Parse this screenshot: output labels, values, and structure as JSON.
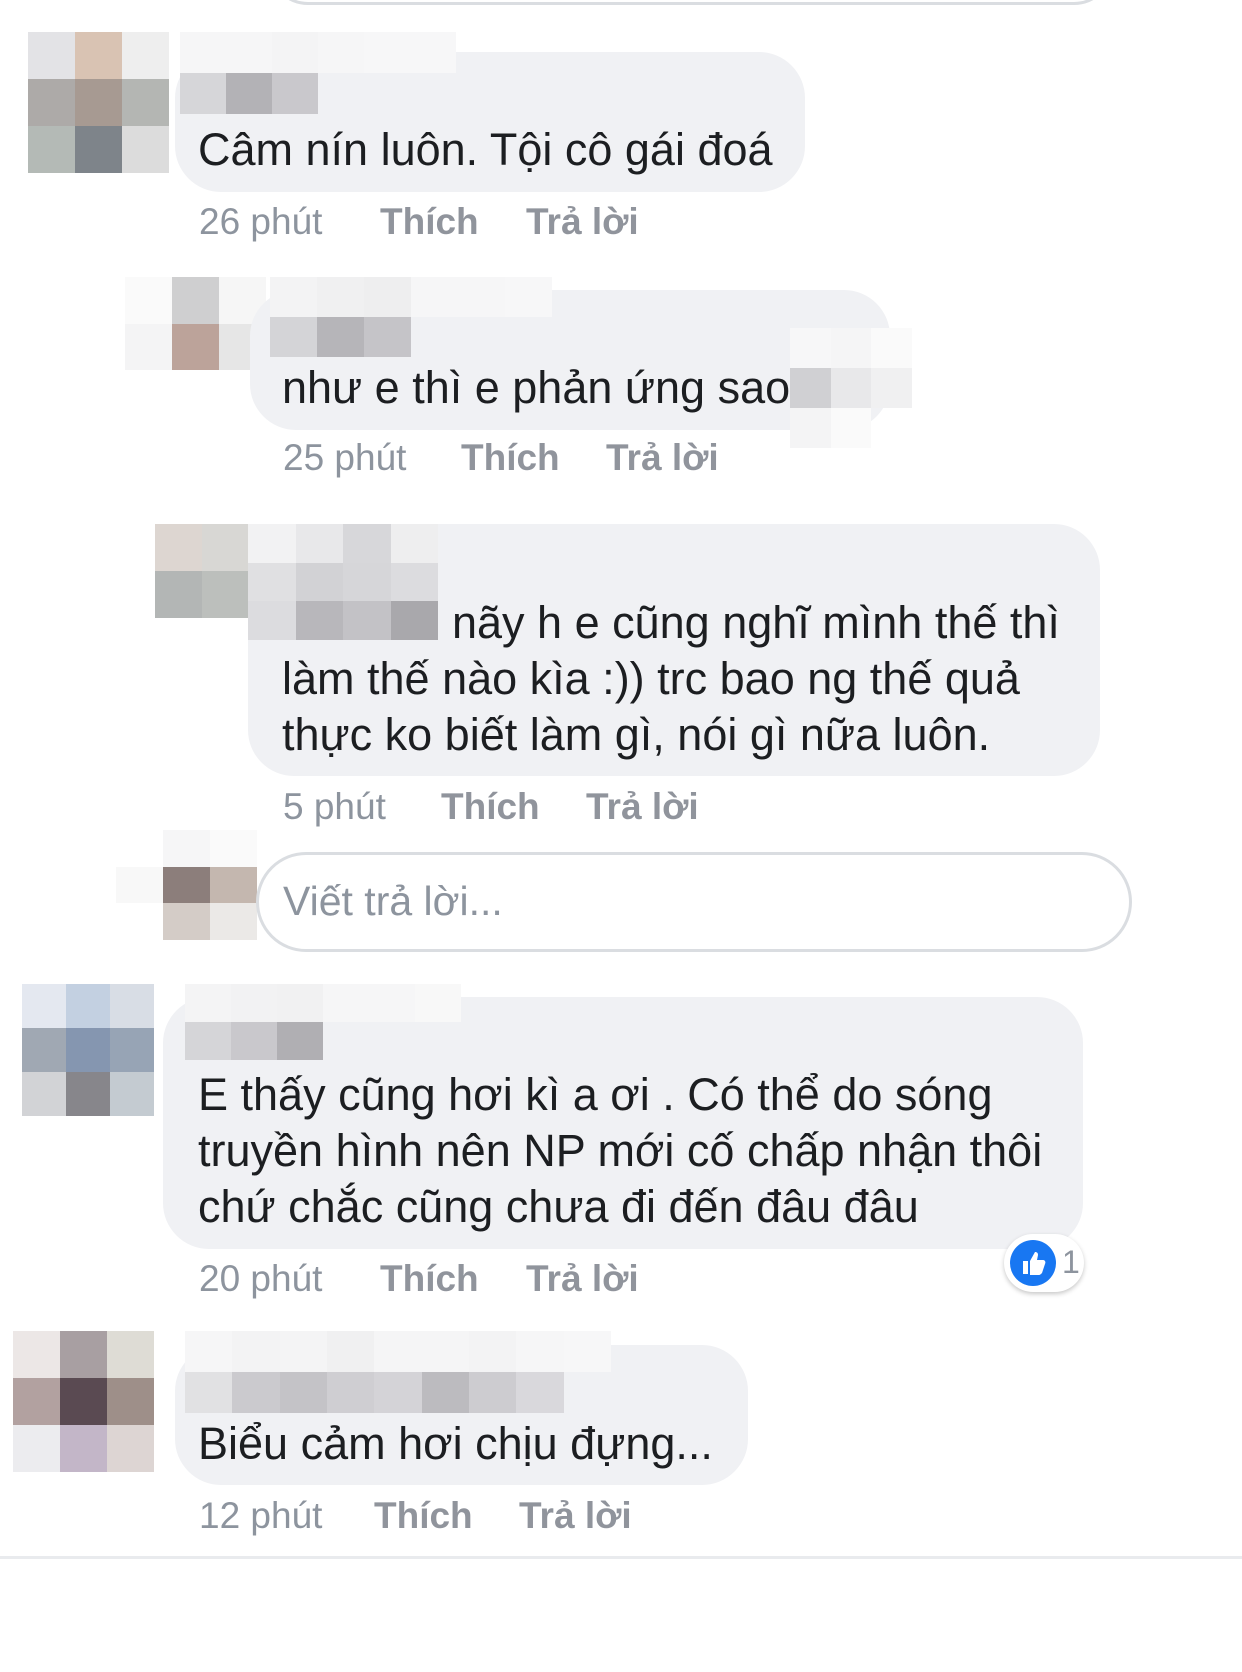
{
  "comments": [
    {
      "text_lines": [
        "Câm nín luôn. Tội cô gái đoá"
      ],
      "time": "26 phút",
      "like_label": "Thích",
      "reply_label": "Trả lời"
    },
    {
      "text_lines": [
        "như e thì e phản ứng sao"
      ],
      "time": "25 phút",
      "like_label": "Thích",
      "reply_label": "Trả lời"
    },
    {
      "text_lines": [
        "nãy h e cũng nghĩ mình thế thì",
        "làm thế nào kìa :)) trc bao ng thế quả",
        "thực ko biết làm gì, nói gì nữa luôn."
      ],
      "time": "5 phút",
      "like_label": "Thích",
      "reply_label": "Trả lời"
    },
    {
      "text_lines": [
        "E thấy cũng hơi kì a ơi . Có thể do sóng",
        "truyền hình nên NP mới cố chấp nhận thôi",
        "chứ chắc cũng chưa đi đến đâu đâu"
      ],
      "time": "20 phút",
      "like_label": "Thích",
      "reply_label": "Trả lời",
      "reaction": {
        "icon": "thumbs-up-icon",
        "count": "1"
      }
    },
    {
      "text_lines": [
        "Biểu cảm hơi chịu đựng..."
      ],
      "time": "12 phút",
      "like_label": "Thích",
      "reply_label": "Trả lời"
    }
  ],
  "reply_input": {
    "placeholder": "Viết trả lời..."
  },
  "colors": {
    "bubble": "#f0f1f4",
    "meta": "#8d949e",
    "like_blue": "#1877f2",
    "border": "#dadde1"
  }
}
